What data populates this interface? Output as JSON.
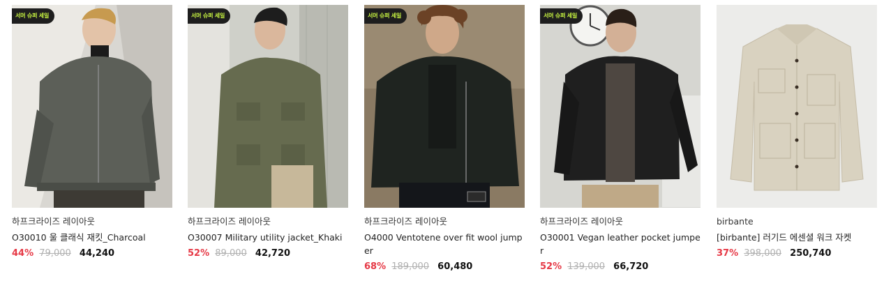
{
  "products": [
    {
      "badge": "서머 슈퍼 세일",
      "brand": "하프크라이즈 레이아웃",
      "title": "O30010 울 클래식 재킷_Charcoal",
      "discount": "44%",
      "original_price": "79,000",
      "sale_price": "44,240",
      "image": "model-charcoal-wool-jacket"
    },
    {
      "badge": "서머 슈퍼 세일",
      "brand": "하프크라이즈 레이아웃",
      "title": "O30007 Military utility jacket_Khaki",
      "discount": "52%",
      "original_price": "89,000",
      "sale_price": "42,720",
      "image": "model-khaki-utility-jacket"
    },
    {
      "badge": "서머 슈퍼 세일",
      "brand": "하프크라이즈 레이아웃",
      "title": "O4000 Ventotene over fit wool jumper",
      "discount": "68%",
      "original_price": "189,000",
      "sale_price": "60,480",
      "image": "model-dark-wool-jumper"
    },
    {
      "badge": "서머 슈퍼 세일",
      "brand": "하프크라이즈 레이아웃",
      "title": "O30001 Vegan leather pocket jumper",
      "discount": "52%",
      "original_price": "139,000",
      "sale_price": "66,720",
      "image": "model-black-leather-jumper"
    },
    {
      "badge": "",
      "brand": "birbante",
      "title": "[birbante] 러기드 에센셜 워크 자켓",
      "discount": "37%",
      "original_price": "398,000",
      "sale_price": "250,740",
      "image": "beige-work-jacket-flatlay"
    }
  ],
  "colors": {
    "discount": "#e63946",
    "badge_bg": "#1e1e1e",
    "badge_text": "#c8f542"
  }
}
